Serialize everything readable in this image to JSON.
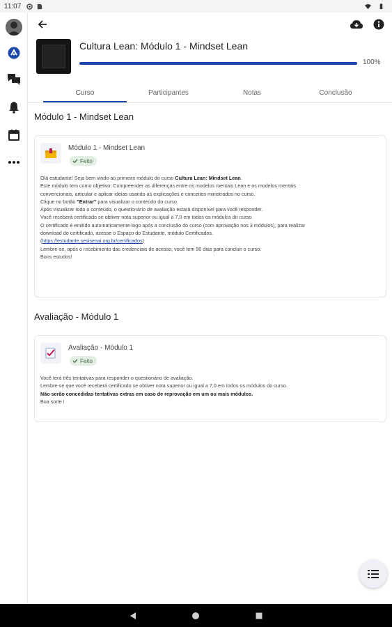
{
  "status_bar": {
    "time": "11:07"
  },
  "app_bar": {
    "back_icon": "arrow-left-icon",
    "download_icon": "cloud-download-icon",
    "info_icon": "info-icon"
  },
  "rail": {
    "items": [
      {
        "icon": "avatar"
      },
      {
        "icon": "dashboard-icon"
      },
      {
        "icon": "chat-icon"
      },
      {
        "icon": "bell-icon"
      },
      {
        "icon": "calendar-icon"
      },
      {
        "icon": "more-icon"
      }
    ]
  },
  "course": {
    "title": "Cultura Lean: Módulo 1 - Mindset Lean",
    "progress_percent": 100,
    "progress_label": "100%"
  },
  "tabs": [
    {
      "label": "Curso",
      "active": true
    },
    {
      "label": "Participantes",
      "active": false
    },
    {
      "label": "Notas",
      "active": false
    },
    {
      "label": "Conclusão",
      "active": false
    }
  ],
  "sections": [
    {
      "title": "Módulo 1 - Mindset Lean",
      "activity": {
        "name": "Módulo 1 - Mindset Lean",
        "badge": "Feito",
        "lines": [
          {
            "a": "Olá estudante! Seja bem vindo ao primeiro módulo do curso ",
            "b": "Cultura Lean: Mindset Lean",
            "c": "."
          },
          {
            "a": "Este módulo tem como objetivo: Compreender as diferenças entre os modelos mentais Lean e os modelos mentais"
          },
          {
            "a": "convencionais, articular e aplicar ideias usando as explicações e conceitos ministrados no curso."
          },
          {
            "a": "Clique no botão ",
            "b": "\"Entrar\"",
            "c": " para visualizar o conteúdo do curso."
          },
          {
            "a": "Após visualizar todo o conteúdo, o questionário de avaliação estará disponível para você responder."
          },
          {
            "a": "Você receberá certificado se obtiver nota superior ou igual a 7,0 em todos os módulos do curso."
          },
          {
            "a": "O certificado é emitido automaticamente logo após a conclusão do curso (com aprovação nos 3 módulos), para realizar"
          },
          {
            "a": "download do certificado, acesse o Espaço do Estudante, módulo Certificados."
          },
          {
            "a": "(",
            "link": "https://estudante.sesisenai.org.br/certificados",
            "c": ")"
          },
          {
            "a": "Lembre-se, após o recebimento das credenciais de acesso, você tem 90 dias para concluir o curso."
          },
          {
            "a": "Bons estudos!"
          }
        ]
      }
    },
    {
      "title": "Avaliação - Módulo 1",
      "activity": {
        "name": "Avaliação - Módulo 1",
        "badge": "Feito",
        "lines": [
          {
            "a": "Você terá três tentativas para responder o questionário de avaliação."
          },
          {
            "a": "Lembre-se que você receberá certificado se obtiver nota superior ou igual a 7,0 em todos os módulos do curso."
          },
          {
            "b": "Não serão concedidas tentativas extras em caso de reprovação em um ou mais módulos."
          },
          {
            "a": "Boa sorte !"
          }
        ]
      }
    }
  ],
  "fab": {
    "icon": "list-icon"
  },
  "navigation_bar": {
    "back": "nav-back-icon",
    "home": "nav-home-icon",
    "recents": "nav-recents-icon"
  }
}
